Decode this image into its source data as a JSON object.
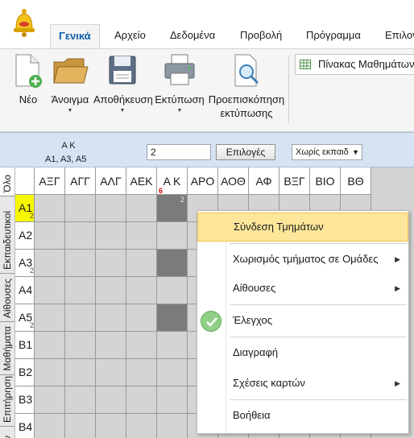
{
  "ribbon": {
    "tabs": [
      "Γενικά",
      "Αρχείο",
      "Δεδομένα",
      "Προβολή",
      "Πρόγραμμα",
      "Επιλογ"
    ],
    "active_tab": "Γενικά",
    "buttons": {
      "new": "Νέο",
      "open": "Άνοιγμα",
      "save": "Αποθήκευση",
      "print": "Εκτύπωση",
      "preview_line1": "Προεπισκόπηση",
      "preview_line2": "εκτύπωσης"
    },
    "subject_table": "Πίνακας Μαθημάτων"
  },
  "info_bar": {
    "label_line1": "Α Κ",
    "label_line2": "Α1, Α3, Α5",
    "input_value": "2",
    "options_button": "Επιλογές",
    "filter_select": "Χωρίς εκπαιδ"
  },
  "side_tabs": [
    "Όλο",
    "Εκπαιδευτικοί",
    "Αίθουσες",
    "Μαθήματα",
    "Επιτήρηση",
    "Αν"
  ],
  "grid": {
    "columns": [
      "ΑΞΓ",
      "ΑΓΓ",
      "ΑΛΓ",
      "ΑΕΚ",
      "Α Κ",
      "ΑΡΟ",
      "ΑΟΘ",
      "ΑΦ",
      "ΒΞΓ",
      "ΒΙΟ",
      "ΒΘ"
    ],
    "marked_column_number": "6",
    "rows": [
      {
        "label": "Α1",
        "sub": "2"
      },
      {
        "label": "Α2",
        "sub": ""
      },
      {
        "label": "Α3",
        "sub": "2"
      },
      {
        "label": "Α4",
        "sub": ""
      },
      {
        "label": "Α5",
        "sub": "2"
      },
      {
        "label": "Β1",
        "sub": ""
      },
      {
        "label": "Β2",
        "sub": ""
      },
      {
        "label": "Β3",
        "sub": ""
      },
      {
        "label": "Β4",
        "sub": ""
      }
    ],
    "cell_value": "2"
  },
  "context_menu": {
    "items": [
      {
        "label": "Σύνδεση Τμημάτων",
        "submenu": false
      },
      {
        "label": "Χωρισμός τμήματος σε Ομάδες",
        "submenu": true
      },
      {
        "label": "Αίθουσες",
        "submenu": true
      },
      {
        "label": "Έλεγχος",
        "submenu": false
      },
      {
        "label": "Διαγραφή",
        "submenu": false
      },
      {
        "label": "Σχέσεις καρτών",
        "submenu": true
      },
      {
        "label": "Βοήθεια",
        "submenu": false
      }
    ]
  },
  "colors": {
    "active_tab_text": "#0a5aa8",
    "highlight_row": "#f7f700",
    "menu_hover": "#fde69a",
    "info_bar": "#d6e3f3",
    "marker_red": "#e00000"
  }
}
